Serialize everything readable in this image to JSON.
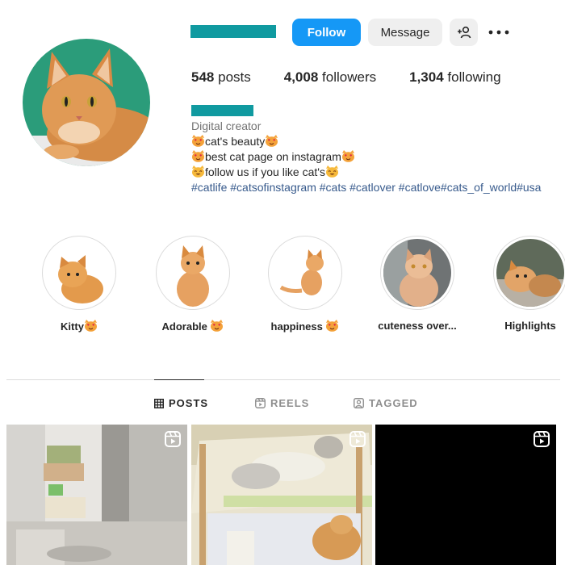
{
  "profile": {
    "follow_label": "Follow",
    "message_label": "Message",
    "stats": {
      "posts_count": "548",
      "posts_label": "posts",
      "followers_count": "4,008",
      "followers_label": "followers",
      "following_count": "1,304",
      "following_label": "following"
    },
    "bio": {
      "category": "Digital creator",
      "line1": "cat's beauty",
      "line2": "best cat page on instagram",
      "line3": "follow us if you like cat's",
      "hashtags": "#catlife #catsofinstagram #cats #catlover #catlove#cats_of_world#usa"
    }
  },
  "highlights": [
    {
      "label": "Kitty",
      "emoji": "cat-heart-eyes"
    },
    {
      "label": "Adorable",
      "emoji": "cat-heart-eyes"
    },
    {
      "label": "happiness",
      "emoji": "cat-heart-eyes"
    },
    {
      "label": "cuteness over...",
      "emoji": ""
    },
    {
      "label": "Highlights",
      "emoji": ""
    }
  ],
  "tabs": {
    "posts": "POSTS",
    "reels": "REELS",
    "tagged": "TAGGED",
    "active": "posts"
  },
  "icons": {
    "reel": "reel-icon",
    "grid": "grid-icon",
    "reels_tab": "reels-icon",
    "tagged": "tagged-icon",
    "add_user": "add-user-icon",
    "more": "more-icon"
  },
  "colors": {
    "follow_button": "#1598f6",
    "hashtag": "#375a8c",
    "redacted": "#109aa0"
  }
}
